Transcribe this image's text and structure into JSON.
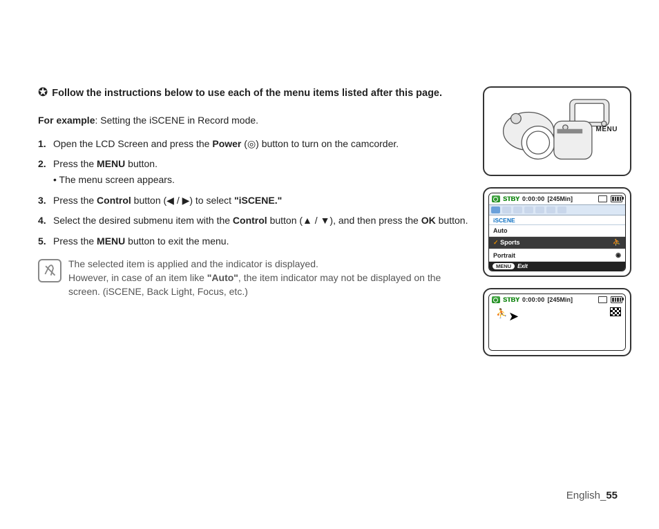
{
  "heading": "Follow the instructions below to use each of the menu items listed after this page.",
  "for_example_label": "For example",
  "for_example_text": ": Setting the iSCENE in Record mode.",
  "steps": [
    {
      "num": "1.",
      "pre": "Open the LCD Screen and press the ",
      "b1": "Power",
      "mid": " (",
      "post": ") button to turn on the camcorder."
    },
    {
      "num": "2.",
      "pre": "Press the ",
      "b1": "MENU",
      "post": " button.",
      "sub": "The menu screen appears."
    },
    {
      "num": "3.",
      "pre": "Press the ",
      "b1": "Control",
      "mid": " button (◀ / ▶) to select ",
      "b2": "\"iSCENE.\""
    },
    {
      "num": "4.",
      "pre": "Select the desired submenu item with the ",
      "b1": "Control",
      "mid": " button (▲ / ▼), and then press the ",
      "b2": "OK",
      "post": " button."
    },
    {
      "num": "5.",
      "pre": "Press the ",
      "b1": "MENU",
      "post": " button to exit the menu."
    }
  ],
  "note_line1": "The selected item is applied and the indicator is displayed.",
  "note_line2_pre": "However, in case of an item like ",
  "note_line2_bold": "\"Auto\"",
  "note_line2_post": ", the item indicator may not be displayed on the screen. (iSCENE, Back Light, Focus, etc.)",
  "camcorder_menu_label": "MENU",
  "lcd1": {
    "stby": "STBY",
    "time": "0:00:00",
    "remaining": "[245Min]",
    "menu_title": "iSCENE",
    "items": [
      "Auto",
      "Sports",
      "Portrait"
    ],
    "footer_pill": "MENU",
    "footer_exit": "Exit"
  },
  "lcd2": {
    "stby": "STBY",
    "time": "0:00:00",
    "remaining": "[245Min]"
  },
  "footer_lang": "English_",
  "footer_page": "55"
}
